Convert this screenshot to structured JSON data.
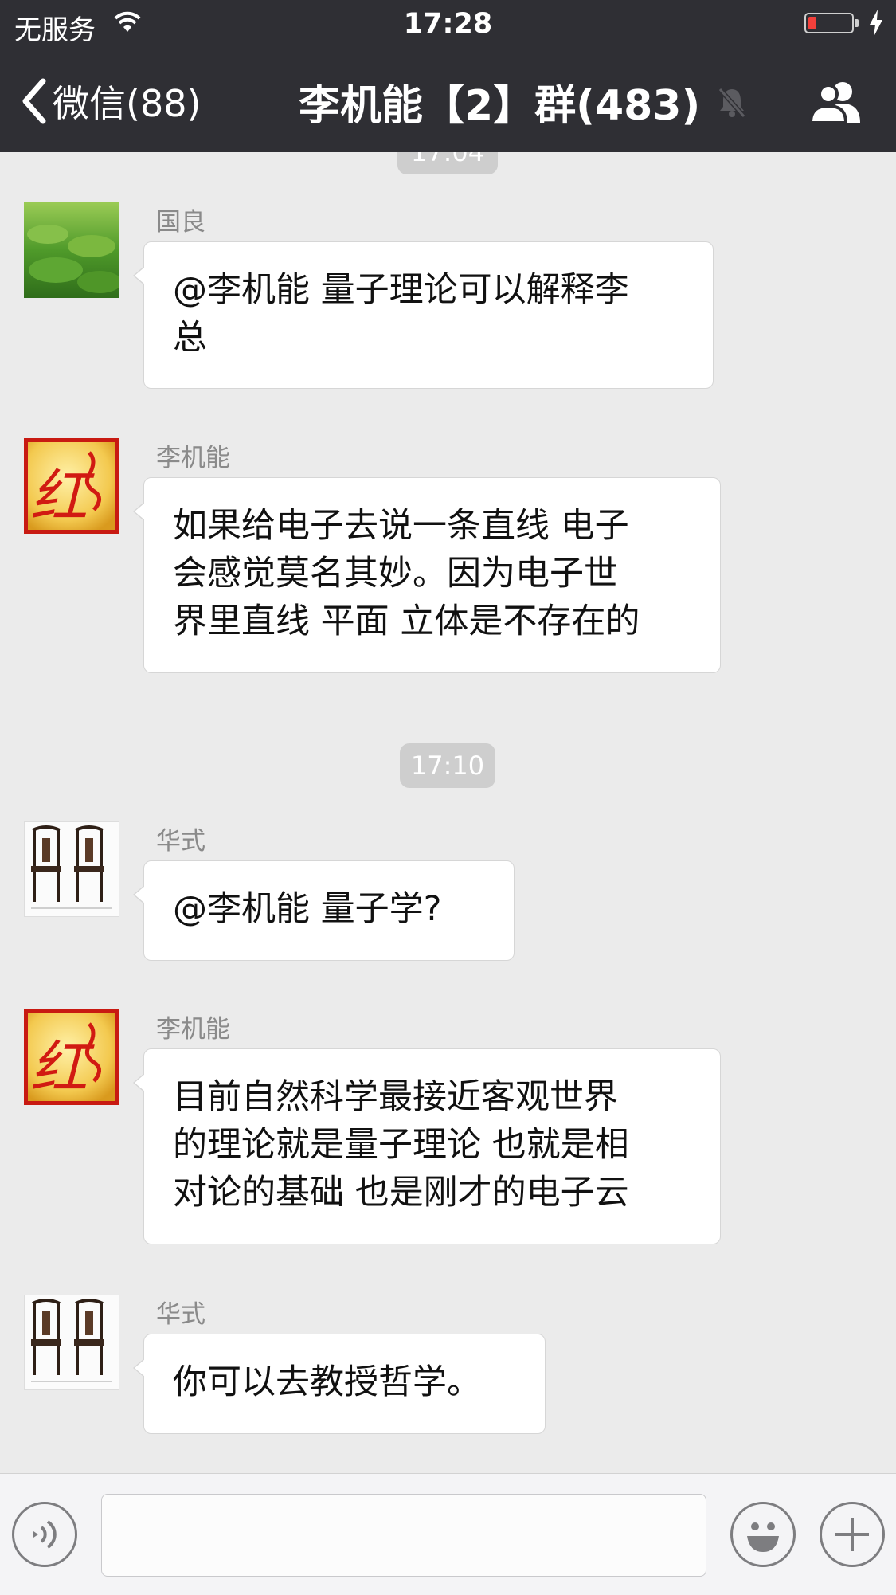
{
  "status_bar": {
    "carrier": "无服务",
    "time": "17:28"
  },
  "nav": {
    "back_label": "微信(88)",
    "title": "李机能【2】群(483)"
  },
  "timestamps": {
    "cut_off": "17:04",
    "second": "17:10"
  },
  "messages": [
    {
      "sender": "国良",
      "lines": [
        "@李机能 量子理论可以解释李",
        "总"
      ]
    },
    {
      "sender": "李机能",
      "lines": [
        "如果给电子去说一条直线  电子",
        "会感觉莫名其妙。因为电子世",
        "界里直线 平面 立体是不存在的"
      ]
    },
    {
      "sender": "华式",
      "lines": [
        "@李机能 量子学?"
      ]
    },
    {
      "sender": "李机能",
      "lines": [
        "目前自然科学最接近客观世界",
        "的理论就是量子理论 也就是相",
        "对论的基础  也是刚才的电子云"
      ]
    },
    {
      "sender": "华式",
      "lines": [
        "你可以去教授哲学。"
      ]
    }
  ],
  "input": {
    "value": ""
  },
  "avatar_fallback": {
    "text": "红"
  },
  "colors": {
    "nav_bg": "#2f2f34",
    "chat_bg": "#ebebeb",
    "battery_low": "#f2403b"
  }
}
